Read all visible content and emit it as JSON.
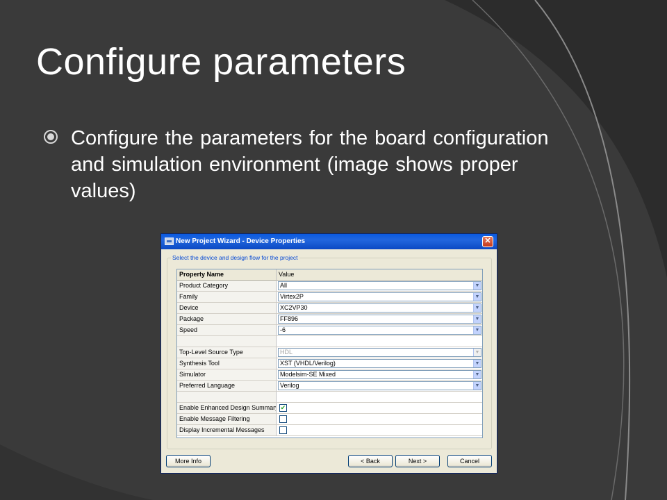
{
  "slide": {
    "title": "Configure parameters",
    "bullet": "Configure the parameters for the board configuration and simulation environment (image shows proper values)"
  },
  "dialog": {
    "title": "New Project Wizard - Device Properties",
    "group_label": "Select the device and design flow for the project",
    "header": {
      "name": "Property Name",
      "value": "Value"
    },
    "rows": [
      {
        "name": "Product Category",
        "value": "All",
        "type": "combo"
      },
      {
        "name": "Family",
        "value": "Virtex2P",
        "type": "combo"
      },
      {
        "name": "Device",
        "value": "XC2VP30",
        "type": "combo"
      },
      {
        "name": "Package",
        "value": "FF896",
        "type": "combo"
      },
      {
        "name": "Speed",
        "value": "-6",
        "type": "combo"
      },
      {
        "name": "",
        "value": "",
        "type": "blank"
      },
      {
        "name": "Top-Level Source Type",
        "value": "HDL",
        "type": "combo-disabled"
      },
      {
        "name": "Synthesis Tool",
        "value": "XST (VHDL/Verilog)",
        "type": "combo"
      },
      {
        "name": "Simulator",
        "value": "Modelsim-SE Mixed",
        "type": "combo"
      },
      {
        "name": "Preferred Language",
        "value": "Verilog",
        "type": "combo"
      },
      {
        "name": "",
        "value": "",
        "type": "blank"
      },
      {
        "name": "Enable Enhanced Design Summary",
        "checked": true,
        "type": "check"
      },
      {
        "name": "Enable Message Filtering",
        "checked": false,
        "type": "check"
      },
      {
        "name": "Display Incremental Messages",
        "checked": false,
        "type": "check"
      }
    ],
    "buttons": {
      "more_info": "More Info",
      "back": "< Back",
      "next": "Next >",
      "cancel": "Cancel"
    }
  }
}
